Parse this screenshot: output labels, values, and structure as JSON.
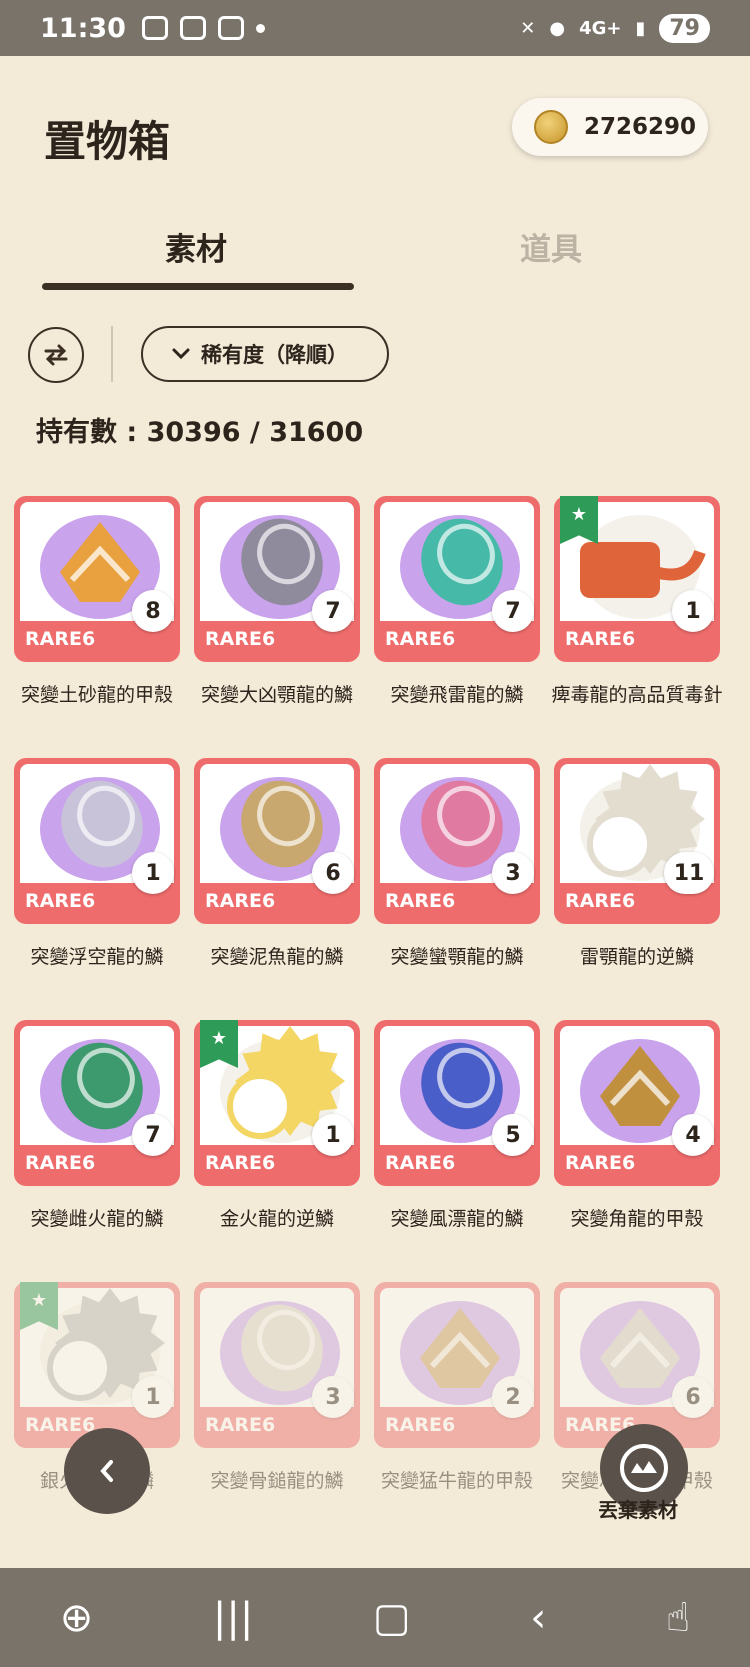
{
  "status": {
    "time": "11:30",
    "network": "4G+",
    "battery": "79"
  },
  "header": {
    "title": "置物箱",
    "coins": "2726290"
  },
  "tabs": [
    {
      "label": "素材"
    },
    {
      "label": "道具"
    }
  ],
  "controls": {
    "sort_label": "稀有度（降順）",
    "count_text": "持有數 : 30396 / 31600"
  },
  "items": [
    {
      "name": "突變土砂龍的甲殼",
      "rarity": "RARE6",
      "qty": "8",
      "icon": "armor-shell-icon",
      "color": "#e9a03f"
    },
    {
      "name": "突變大凶顎龍的鱗",
      "rarity": "RARE6",
      "qty": "7",
      "icon": "scale-icon",
      "color": "#8f8a9c"
    },
    {
      "name": "突變飛雷龍的鱗",
      "rarity": "RARE6",
      "qty": "7",
      "icon": "scale-icon",
      "color": "#46b9a8"
    },
    {
      "name": "痺毒龍的高品質毒針",
      "rarity": "RARE6",
      "qty": "1",
      "icon": "poison-stinger-icon",
      "color": "#e0643a",
      "starred": true
    },
    {
      "name": "突變浮空龍的鱗",
      "rarity": "RARE6",
      "qty": "1",
      "icon": "scale-icon",
      "color": "#c9c3d9"
    },
    {
      "name": "突變泥魚龍的鱗",
      "rarity": "RARE6",
      "qty": "6",
      "icon": "scale-icon",
      "color": "#c8a86e"
    },
    {
      "name": "突變蠻顎龍的鱗",
      "rarity": "RARE6",
      "qty": "3",
      "icon": "scale-icon",
      "color": "#e07aa0"
    },
    {
      "name": "雷顎龍的逆鱗",
      "rarity": "RARE6",
      "qty": "11",
      "icon": "spiky-scale-icon",
      "color": "#e3ddd0"
    },
    {
      "name": "突變雌火龍的鱗",
      "rarity": "RARE6",
      "qty": "7",
      "icon": "scale-icon",
      "color": "#3d9a6e"
    },
    {
      "name": "金火龍的逆鱗",
      "rarity": "RARE6",
      "qty": "1",
      "icon": "spiky-scale-icon",
      "color": "#f3d663",
      "starred": true
    },
    {
      "name": "突變風漂龍的鱗",
      "rarity": "RARE6",
      "qty": "5",
      "icon": "scale-icon",
      "color": "#4a5ec9"
    },
    {
      "name": "突變角龍的甲殼",
      "rarity": "RARE6",
      "qty": "4",
      "icon": "armor-shell-icon",
      "color": "#c0903e"
    },
    {
      "name": "銀火龍的逆鱗",
      "rarity": "RARE6",
      "qty": "1",
      "icon": "spiky-scale-icon",
      "color": "#b9b9b9",
      "starred": true
    },
    {
      "name": "突變骨鎚龍的鱗",
      "rarity": "RARE6",
      "qty": "3",
      "icon": "scale-icon",
      "color": "#d8d3c8"
    },
    {
      "name": "突變猛牛龍的甲殼",
      "rarity": "RARE6",
      "qty": "2",
      "icon": "armor-shell-icon",
      "color": "#c79e62"
    },
    {
      "name": "突變冰牙龍的甲殼",
      "rarity": "RARE6",
      "qty": "6",
      "icon": "armor-shell-icon",
      "color": "#cfc9c2"
    }
  ],
  "discard_label": "丟棄素材"
}
